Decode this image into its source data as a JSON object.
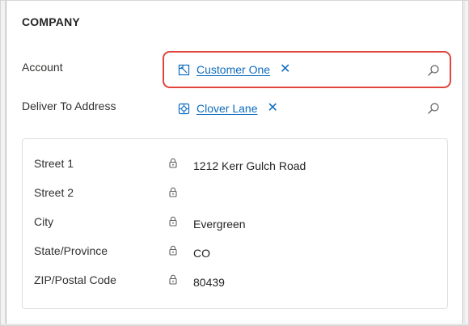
{
  "section": {
    "title": "COMPANY"
  },
  "account": {
    "label": "Account",
    "value": "Customer One",
    "icon": "account-entity-icon",
    "remove_glyph": "✕",
    "highlight_color": "#e0453c"
  },
  "deliver_to": {
    "label": "Deliver To Address",
    "value": "Clover Lane",
    "icon": "address-entity-icon",
    "remove_glyph": "✕"
  },
  "address": {
    "rows": [
      {
        "label": "Street 1",
        "value": "1212 Kerr Gulch Road"
      },
      {
        "label": "Street 2",
        "value": ""
      },
      {
        "label": "City",
        "value": "Evergreen"
      },
      {
        "label": "State/Province",
        "value": "CO"
      },
      {
        "label": "ZIP/Postal Code",
        "value": "80439"
      }
    ]
  },
  "colors": {
    "link": "#0f6cbd",
    "text": "#323130",
    "border": "#e1dfdd"
  }
}
